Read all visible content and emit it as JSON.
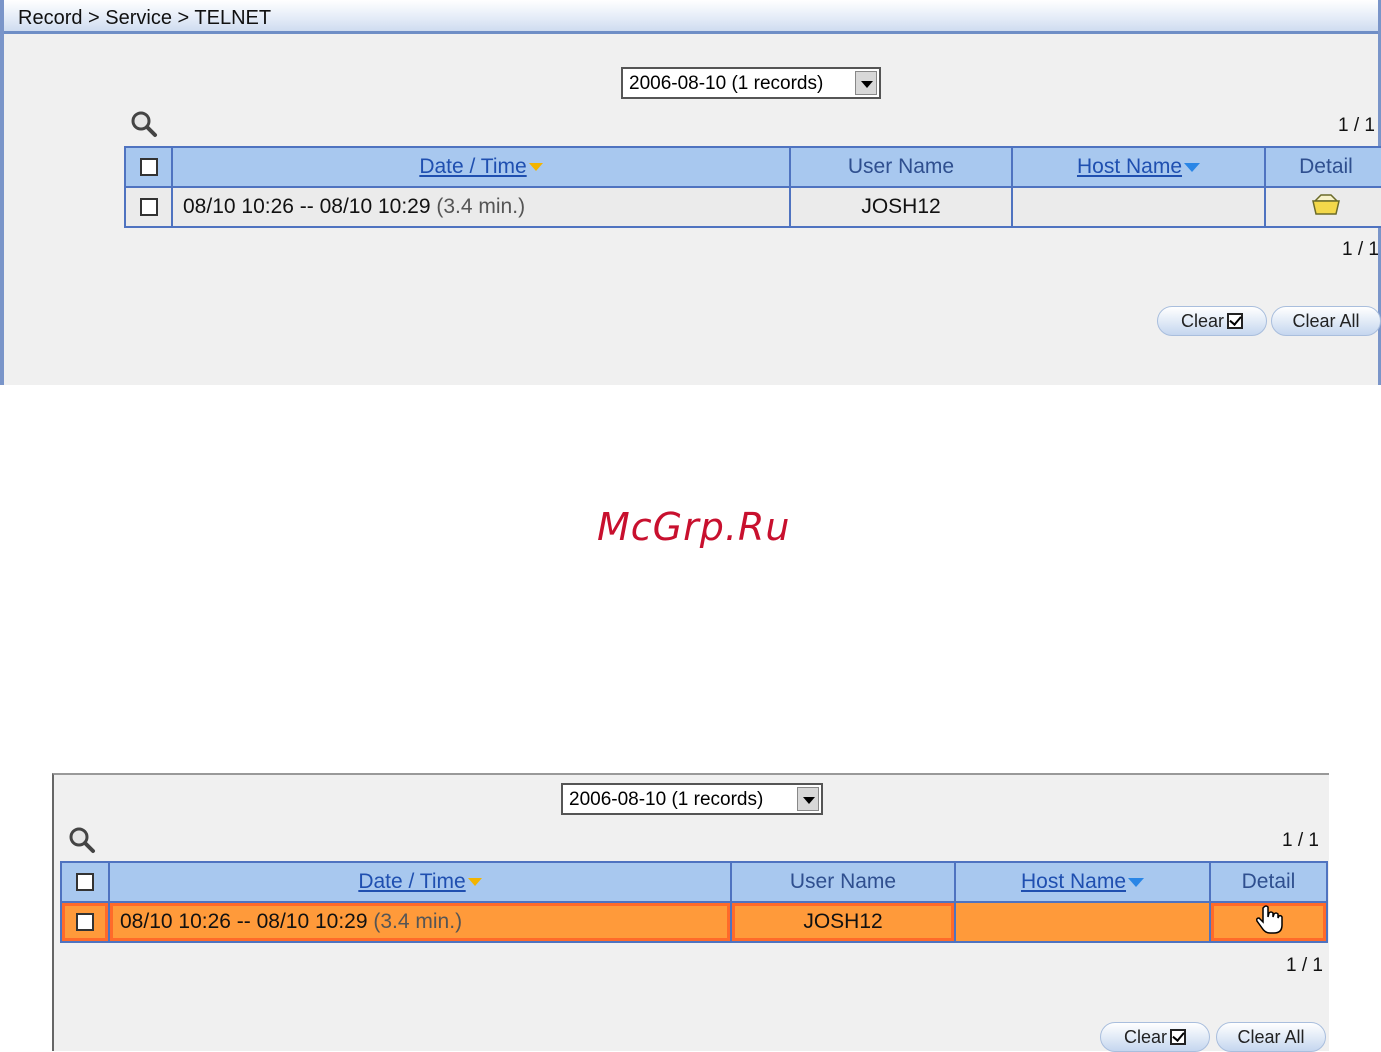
{
  "panel1": {
    "breadcrumb": "Record > Service > TELNET",
    "date_select": "2006-08-10 (1 records)",
    "pager_top": "1 / 1",
    "pager_bottom": "1 / 1",
    "columns": {
      "datetime": "Date / Time",
      "user": "User Name",
      "host": "Host Name",
      "detail": "Detail"
    },
    "row": {
      "datetime": "08/10 10:26 -- 08/10 10:29",
      "duration": "(3.4 min.)",
      "user": "JOSH12",
      "host": ""
    },
    "buttons": {
      "clear": "Clear",
      "clear_all": "Clear All"
    }
  },
  "watermark": "McGrp.Ru",
  "panel2": {
    "date_select": "2006-08-10 (1 records)",
    "pager_top": "1 / 1",
    "pager_bottom": "1 / 1",
    "columns": {
      "datetime": "Date / Time",
      "user": "User Name",
      "host": "Host Name",
      "detail": "Detail"
    },
    "row": {
      "datetime": "08/10 10:26 -- 08/10 10:29",
      "duration": "(3.4 min.)",
      "user": "JOSH12",
      "host": ""
    },
    "buttons": {
      "clear": "Clear",
      "clear_all": "Clear All"
    }
  },
  "colors": {
    "header_bg": "#a8c8ef",
    "grid_border": "#4f73c0",
    "selected_row": "#ff9a3a",
    "watermark": "#c8102e"
  }
}
